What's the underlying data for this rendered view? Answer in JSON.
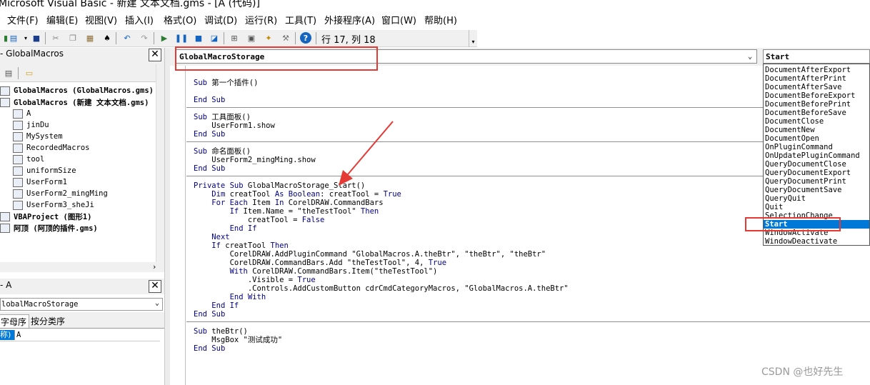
{
  "window": {
    "title": "Microsoft Visual Basic - 新建 文本文档.gms - [A (代码)]"
  },
  "menu": {
    "items": [
      "文件(F)",
      "编辑(E)",
      "视图(V)",
      "插入(I)",
      "格式(O)",
      "调试(D)",
      "运行(R)",
      "工具(T)",
      "外接程序(A)",
      "窗口(W)",
      "帮助(H)"
    ]
  },
  "toolbar": {
    "position_text": "行 17, 列 18",
    "icons": [
      "view-excel-icon",
      "insert-userform-icon",
      "save-icon",
      "cut-icon",
      "copy-icon",
      "paste-icon",
      "find-icon",
      "undo-icon",
      "redo-icon",
      "run-icon",
      "break-icon",
      "reset-icon",
      "design-mode-icon",
      "project-explorer-icon",
      "properties-icon",
      "object-browser-icon",
      "toolbox-icon",
      "help-icon"
    ]
  },
  "project": {
    "title": "- GlobalMacros",
    "close": "✕",
    "tree": [
      {
        "label": "GlobalMacros (GlobalMacros.gms)",
        "bold": true,
        "icon": "project-icon"
      },
      {
        "label": "GlobalMacros (新建 文本文档.gms)",
        "bold": true,
        "icon": "project-icon"
      },
      {
        "label": "A",
        "bold": false,
        "icon": "module-icon"
      },
      {
        "label": "jinDu",
        "bold": false,
        "icon": "form-icon"
      },
      {
        "label": "MySystem",
        "bold": false,
        "icon": "module-icon"
      },
      {
        "label": "RecordedMacros",
        "bold": false,
        "icon": "module-icon"
      },
      {
        "label": "tool",
        "bold": false,
        "icon": "module-icon"
      },
      {
        "label": "uniformSize",
        "bold": false,
        "icon": "module-icon"
      },
      {
        "label": "UserForm1",
        "bold": false,
        "icon": "form-icon"
      },
      {
        "label": "UserForm2_mingMing",
        "bold": false,
        "icon": "form-icon"
      },
      {
        "label": "UserForm3_sheJi",
        "bold": false,
        "icon": "form-icon"
      },
      {
        "label": "VBAProject (图形1)",
        "bold": true,
        "icon": "project-icon"
      },
      {
        "label": "阿顶 (阿顶的插件.gms)",
        "bold": true,
        "icon": "project-icon"
      }
    ]
  },
  "properties": {
    "title": "- A",
    "combo_value": "lobalMacroStorage",
    "tabs": [
      "字母序",
      "按分类序"
    ],
    "row_name": "称)",
    "row_value": "A"
  },
  "code": {
    "object_combo": "GlobalMacroStorage",
    "procedure_combo": "Start",
    "lines": [
      {
        "text": "",
        "divider_before": false
      },
      {
        "text": "Sub 第一个插件()",
        "divider_before": false
      },
      {
        "text": "",
        "divider_before": false
      },
      {
        "text": "End Sub",
        "divider_before": false
      },
      {
        "text": "Sub 工具面板()",
        "divider_before": true
      },
      {
        "text": "    UserForm1.show",
        "divider_before": false
      },
      {
        "text": "End Sub",
        "divider_before": false
      },
      {
        "text": "Sub 命名面板()",
        "divider_before": true
      },
      {
        "text": "    UserForm2_mingMing.show",
        "divider_before": false
      },
      {
        "text": "End Sub",
        "divider_before": false
      },
      {
        "text": "Private Sub GlobalMacroStorage_Start()",
        "divider_before": true
      },
      {
        "text": "    Dim creatTool As Boolean: creatTool = True",
        "divider_before": false
      },
      {
        "text": "    For Each Item In CorelDRAW.CommandBars",
        "divider_before": false
      },
      {
        "text": "        If Item.Name = \"theTestTool\" Then",
        "divider_before": false
      },
      {
        "text": "            creatTool = False",
        "divider_before": false
      },
      {
        "text": "        End If",
        "divider_before": false
      },
      {
        "text": "    Next",
        "divider_before": false
      },
      {
        "text": "    If creatTool Then",
        "divider_before": false
      },
      {
        "text": "        CorelDRAW.AddPluginCommand \"GlobalMacros.A.theBtr\", \"theBtr\", \"theBtr\"",
        "divider_before": false
      },
      {
        "text": "        CorelDRAW.CommandBars.Add \"theTestTool\", 4, True",
        "divider_before": false
      },
      {
        "text": "        With CorelDRAW.CommandBars.Item(\"theTestTool\")",
        "divider_before": false
      },
      {
        "text": "            .Visible = True",
        "divider_before": false
      },
      {
        "text": "            .Controls.AddCustomButton cdrCmdCategoryMacros, \"GlobalMacros.A.theBtr\"",
        "divider_before": false
      },
      {
        "text": "        End With",
        "divider_before": false
      },
      {
        "text": "    End If",
        "divider_before": false
      },
      {
        "text": "End Sub",
        "divider_before": false
      },
      {
        "text": "Sub theBtr()",
        "divider_before": true
      },
      {
        "text": "    MsgBox \"测试成功\"",
        "divider_before": false
      },
      {
        "text": "End Sub",
        "divider_before": false
      }
    ]
  },
  "procedure_list": {
    "items": [
      "DocumentAfterExport",
      "DocumentAfterPrint",
      "DocumentAfterSave",
      "DocumentBeforeExport",
      "DocumentBeforePrint",
      "DocumentBeforeSave",
      "DocumentClose",
      "DocumentNew",
      "DocumentOpen",
      "OnPluginCommand",
      "OnUpdatePluginCommand",
      "QueryDocumentClose",
      "QueryDocumentExport",
      "QueryDocumentPrint",
      "QueryDocumentSave",
      "QueryQuit",
      "Quit",
      "SelectionChange",
      "Start",
      "WindowActivate",
      "WindowDeactivate"
    ],
    "selected": "Start"
  },
  "annotations": {
    "highlight_color": "#e53935"
  },
  "watermark": "CSDN @也好先生"
}
